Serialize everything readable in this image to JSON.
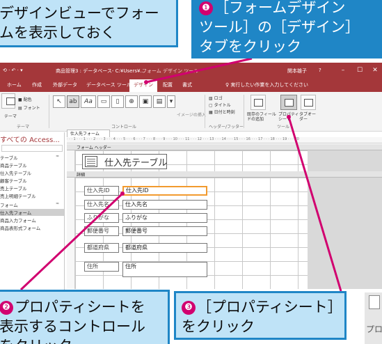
{
  "callouts": {
    "top_left_line1": "デザインビューでフォー",
    "top_left_line2": "ムを表示しておく",
    "top_left_visible_line2": "ムを表示しておく",
    "top_right_step": "❶",
    "top_right_line1": "［フォームデザイン",
    "top_right_line2": "ツール］の［デザイン］",
    "top_right_line3": "タブをクリック",
    "bottom_left_step": "❷",
    "bottom_left_line1": "プロパティシートを",
    "bottom_left_line2": "表示するコントロール",
    "bottom_left_line3": "をクリック",
    "bottom_mid_step": "❸",
    "bottom_mid_line1": "［プロパティシート］",
    "bottom_mid_line2": "をクリック",
    "partial_right_text": "プロ"
  },
  "window": {
    "title": "商品管理3 : データベース- C:¥Users¥...",
    "context_tool": "フォーム デザイン ツール",
    "user": "関本雄子",
    "help": "?",
    "minimize": "–",
    "restore": "☐",
    "close": "✕"
  },
  "ribbon_tabs": [
    "ホーム",
    "作成",
    "外部データ",
    "データベース ツール",
    "デザイン",
    "配置",
    "書式"
  ],
  "tell_me": "実行したい作業を入力してください",
  "ribbon": {
    "view_label": "表示",
    "theme_label": "テーマ",
    "colors_label": "配色",
    "fonts_label": "フォント",
    "group_theme": "テーマ",
    "text_aa": "Aa",
    "group_controls": "コントロール",
    "insert_image": "イメージの挿入",
    "logo": "ロゴ",
    "title": "タイトル",
    "datetime": "日付と時刻",
    "group_header": "ヘッダー/フッター",
    "add_existing": "既存のフィールドの追加",
    "property_sheet": "プロパティシート",
    "tab_order": "タブオーダー",
    "group_tools": "ツール"
  },
  "nav": {
    "header": "すべての Access...",
    "items": [
      "テーブル",
      "商品テーブル",
      "仕入先テーブル",
      "顧客テーブル",
      "売上テーブル",
      "売上明細テーブル",
      "フォーム",
      "仕入先フォーム",
      "商品入力フォーム",
      "商品表形式フォーム"
    ]
  },
  "doc_tab": "仕入先フォーム",
  "ruler_text": "· · · 1 · · · 1 · · · 2 · · · 3 · · · 4 · · · 5 · · · 6 · · · 7 · · · 8 · · · 9 · · · 10 · · · 11 · · · 12 · · · 13 · · · 14 · · · 15 · · · 16 · · · 17 · · · 18 · · · 19 · · · 20",
  "sections": {
    "header": "フォーム ヘッダー",
    "detail": "詳細"
  },
  "form": {
    "title": "仕入先テーブル",
    "labels": [
      "仕入先ID",
      "仕入先名",
      "ふりがな",
      "郵便番号",
      "都道府県",
      "住所"
    ],
    "fields": [
      "仕入先ID",
      "仕入先名",
      "ふりがな",
      "郵便番号",
      "都道府県",
      "住所"
    ]
  },
  "colors": {
    "accent": "#a4373a",
    "callout_border": "#1f86c6",
    "callout_fill": "#bfe3f7",
    "step_badge": "#d1006f",
    "selection": "#f29a2e"
  }
}
